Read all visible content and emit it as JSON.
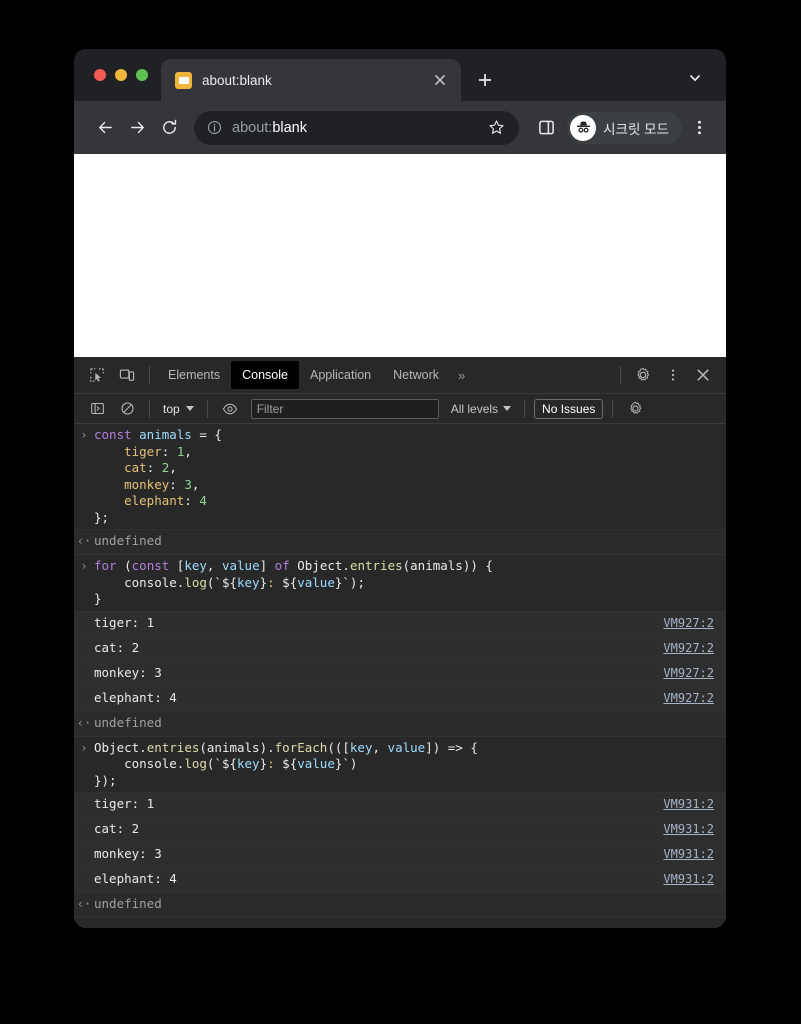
{
  "window": {
    "traffic_lights": [
      "close",
      "minimize",
      "maximize"
    ]
  },
  "tab_strip": {
    "tab": {
      "title": "about:blank",
      "favicon_name": "page-favicon",
      "close_label": "✕"
    },
    "new_tab_label": "+",
    "tab_search_label": "∨"
  },
  "toolbar": {
    "back_label": "←",
    "forward_label": "→",
    "reload_label": "↻",
    "url_scheme": "about:",
    "url_host": "blank",
    "info_icon_label": "ⓘ",
    "star_label": "☆",
    "side_panel_label": "▣",
    "incognito_label": "시크릿 모드",
    "menu_label": "⋮"
  },
  "devtools": {
    "tabs": [
      {
        "label": "Elements",
        "active": false
      },
      {
        "label": "Console",
        "active": true
      },
      {
        "label": "Application",
        "active": false
      },
      {
        "label": "Network",
        "active": false
      }
    ],
    "overflow_label": "»",
    "settings_label": "settings-gear",
    "more_label": "⋮",
    "close_label": "✕",
    "inspect_icon": "inspect-element-icon",
    "device_icon": "device-toolbar-icon",
    "filter_bar": {
      "sidebar_toggle": "console-sidebar-icon",
      "clear_console": "clear-console-icon",
      "context": "top",
      "live_expression": "eye-icon",
      "filter_placeholder": "Filter",
      "filter_value": "",
      "levels": "All levels",
      "issues": "No Issues",
      "settings": "console-settings-gear"
    },
    "colors": {
      "panel_bg": "#282828",
      "active_tab_bg": "#000000",
      "log_row_bg": "#2e2e2e",
      "result_row_bg": "#2b2b2b",
      "source_link": "#a5b3c7"
    }
  },
  "console_entries": [
    {
      "kind": "input",
      "gutter": "›",
      "lines": [
        [
          {
            "t": "const ",
            "c": "kw"
          },
          {
            "t": "animals ",
            "c": "var"
          },
          {
            "t": "= {",
            "c": "pln"
          }
        ],
        [
          {
            "t": "    ",
            "c": "pln"
          },
          {
            "t": "tiger",
            "c": "prop"
          },
          {
            "t": ": ",
            "c": "pln"
          },
          {
            "t": "1",
            "c": "num"
          },
          {
            "t": ",",
            "c": "pln"
          }
        ],
        [
          {
            "t": "    ",
            "c": "pln"
          },
          {
            "t": "cat",
            "c": "prop"
          },
          {
            "t": ": ",
            "c": "pln"
          },
          {
            "t": "2",
            "c": "num"
          },
          {
            "t": ",",
            "c": "pln"
          }
        ],
        [
          {
            "t": "    ",
            "c": "pln"
          },
          {
            "t": "monkey",
            "c": "prop"
          },
          {
            "t": ": ",
            "c": "pln"
          },
          {
            "t": "3",
            "c": "num"
          },
          {
            "t": ",",
            "c": "pln"
          }
        ],
        [
          {
            "t": "    ",
            "c": "pln"
          },
          {
            "t": "elephant",
            "c": "prop"
          },
          {
            "t": ": ",
            "c": "pln"
          },
          {
            "t": "4",
            "c": "num"
          }
        ],
        [
          {
            "t": "};",
            "c": "pln"
          }
        ]
      ]
    },
    {
      "kind": "result",
      "gutter": "‹·",
      "lines": [
        [
          {
            "t": "undefined",
            "c": "undef"
          }
        ]
      ]
    },
    {
      "kind": "input",
      "gutter": "›",
      "lines": [
        [
          {
            "t": "for ",
            "c": "kw"
          },
          {
            "t": "(",
            "c": "pln"
          },
          {
            "t": "const ",
            "c": "kw"
          },
          {
            "t": "[",
            "c": "pln"
          },
          {
            "t": "key",
            "c": "var"
          },
          {
            "t": ", ",
            "c": "pln"
          },
          {
            "t": "value",
            "c": "var"
          },
          {
            "t": "] ",
            "c": "pln"
          },
          {
            "t": "of ",
            "c": "kw"
          },
          {
            "t": "Object",
            "c": "pln"
          },
          {
            "t": ".",
            "c": "pln"
          },
          {
            "t": "entries",
            "c": "fn"
          },
          {
            "t": "(animals)) {",
            "c": "pln"
          }
        ],
        [
          {
            "t": "    console.",
            "c": "pln"
          },
          {
            "t": "log",
            "c": "fn"
          },
          {
            "t": "(`${",
            "c": "pln"
          },
          {
            "t": "key",
            "c": "var"
          },
          {
            "t": "}",
            "c": "pln"
          },
          {
            "t": ": ",
            "c": "prop"
          },
          {
            "t": "${",
            "c": "pln"
          },
          {
            "t": "value",
            "c": "var"
          },
          {
            "t": "}`);",
            "c": "pln"
          }
        ],
        [
          {
            "t": "}",
            "c": "pln"
          }
        ]
      ]
    },
    {
      "kind": "log",
      "gutter": "",
      "text": "tiger: 1",
      "source": "VM927:2"
    },
    {
      "kind": "log",
      "gutter": "",
      "text": "cat: 2",
      "source": "VM927:2"
    },
    {
      "kind": "log",
      "gutter": "",
      "text": "monkey: 3",
      "source": "VM927:2"
    },
    {
      "kind": "log",
      "gutter": "",
      "text": "elephant: 4",
      "source": "VM927:2"
    },
    {
      "kind": "result",
      "gutter": "‹·",
      "lines": [
        [
          {
            "t": "undefined",
            "c": "undef"
          }
        ]
      ]
    },
    {
      "kind": "input",
      "gutter": "›",
      "lines": [
        [
          {
            "t": "Object",
            "c": "pln"
          },
          {
            "t": ".",
            "c": "pln"
          },
          {
            "t": "entries",
            "c": "fn"
          },
          {
            "t": "(animals).",
            "c": "pln"
          },
          {
            "t": "forEach",
            "c": "fn"
          },
          {
            "t": "(([",
            "c": "pln"
          },
          {
            "t": "key",
            "c": "var"
          },
          {
            "t": ", ",
            "c": "pln"
          },
          {
            "t": "value",
            "c": "var"
          },
          {
            "t": "]) => {",
            "c": "pln"
          }
        ],
        [
          {
            "t": "    console.",
            "c": "pln"
          },
          {
            "t": "log",
            "c": "fn"
          },
          {
            "t": "(`${",
            "c": "pln"
          },
          {
            "t": "key",
            "c": "var"
          },
          {
            "t": "}",
            "c": "pln"
          },
          {
            "t": ": ",
            "c": "prop"
          },
          {
            "t": "${",
            "c": "pln"
          },
          {
            "t": "value",
            "c": "var"
          },
          {
            "t": "}`)",
            "c": "pln"
          }
        ],
        [
          {
            "t": "});",
            "c": "pln"
          }
        ]
      ]
    },
    {
      "kind": "log",
      "gutter": "",
      "text": "tiger: 1",
      "source": "VM931:2"
    },
    {
      "kind": "log",
      "gutter": "",
      "text": "cat: 2",
      "source": "VM931:2"
    },
    {
      "kind": "log",
      "gutter": "",
      "text": "monkey: 3",
      "source": "VM931:2"
    },
    {
      "kind": "log",
      "gutter": "",
      "text": "elephant: 4",
      "source": "VM931:2"
    },
    {
      "kind": "result",
      "gutter": "‹·",
      "lines": [
        [
          {
            "t": "undefined",
            "c": "undef"
          }
        ]
      ]
    }
  ]
}
